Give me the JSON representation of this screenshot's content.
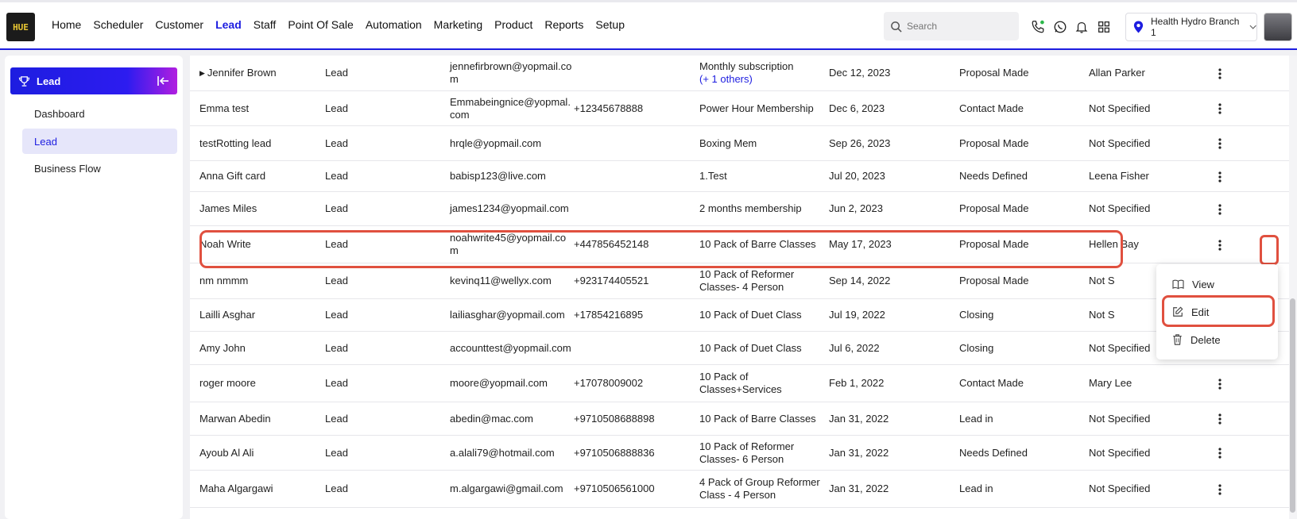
{
  "brand": {
    "logo_text": "HUE"
  },
  "nav": {
    "items": [
      "Home",
      "Scheduler",
      "Customer",
      "Lead",
      "Staff",
      "Point Of Sale",
      "Automation",
      "Marketing",
      "Product",
      "Reports",
      "Setup"
    ],
    "active": "Lead"
  },
  "header": {
    "search_placeholder": "Search",
    "branch": "Health Hydro Branch 1"
  },
  "sidebar": {
    "title": "Lead",
    "items": [
      {
        "label": "Dashboard",
        "active": false
      },
      {
        "label": "Lead",
        "active": true
      },
      {
        "label": "Business Flow",
        "active": false
      }
    ]
  },
  "table": {
    "rows": [
      {
        "name": "Jennifer Brown",
        "expand": "▶",
        "type": "Lead",
        "email1": "jennefirbrown@yopmail.co",
        "email2": "m",
        "phone": "",
        "plan1": "Monthly subscription",
        "plan2": "(+ 1 others)",
        "date": "Dec 12, 2023",
        "status": "Proposal Made",
        "staff": "Allan Parker"
      },
      {
        "name": "Emma test",
        "type": "Lead",
        "email1": "Emmabeingnice@yopmal.",
        "email2": "com",
        "phone": "+12345678888",
        "plan1": "Power Hour Membership",
        "plan2": "",
        "date": "Dec 6, 2023",
        "status": "Contact Made",
        "staff": "Not Specified"
      },
      {
        "name": "testRotting lead",
        "type": "Lead",
        "email1": "hrqle@yopmail.com",
        "email2": "",
        "phone": "",
        "plan1": "Boxing Mem",
        "plan2": "",
        "date": "Sep 26, 2023",
        "status": "Proposal Made",
        "staff": "Not Specified"
      },
      {
        "name": "Anna Gift card",
        "type": "Lead",
        "email1": "babisp123@live.com",
        "email2": "",
        "phone": "",
        "plan1": "1.Test",
        "plan2": "",
        "date": "Jul 20, 2023",
        "status": "Needs Defined",
        "staff": "Leena Fisher"
      },
      {
        "name": "James Miles",
        "type": "Lead",
        "email1": "james1234@yopmail.com",
        "email2": "",
        "phone": "",
        "plan1": "2 months membership",
        "plan2": "",
        "date": "Jun 2, 2023",
        "status": "Proposal Made",
        "staff": "Not Specified"
      },
      {
        "name": "Noah Write",
        "type": "Lead",
        "email1": "noahwrite45@yopmail.co",
        "email2": "m",
        "phone": "+447856452148",
        "plan1": "10 Pack of Barre Classes",
        "plan2": "",
        "date": "May 17, 2023",
        "status": "Proposal Made",
        "staff": "Hellen Bay"
      },
      {
        "name": "nm nmmm",
        "type": "Lead",
        "email1": "kevinq11@wellyx.com",
        "email2": "",
        "phone": "+923174405521",
        "plan1": "10 Pack of Reformer",
        "plan2": "Classes- 4 Person",
        "date": "Sep 14, 2022",
        "status": "Proposal Made",
        "staff": "Not S"
      },
      {
        "name": "Lailli Asghar",
        "type": "Lead",
        "email1": "lailiasghar@yopmail.com",
        "email2": "",
        "phone": "+17854216895",
        "plan1": "10 Pack of Duet Class",
        "plan2": "",
        "date": "Jul 19, 2022",
        "status": "Closing",
        "staff": "Not S"
      },
      {
        "name": "Amy John",
        "type": "Lead",
        "email1": "accounttest@yopmail.com",
        "email2": "",
        "phone": "",
        "plan1": "10 Pack of Duet Class",
        "plan2": "",
        "date": "Jul 6, 2022",
        "status": "Closing",
        "staff": "Not Specified"
      },
      {
        "name": "roger moore",
        "type": "Lead",
        "email1": "moore@yopmail.com",
        "email2": "",
        "phone": "+17078009002",
        "plan1": "10 Pack of",
        "plan2": "Classes+Services",
        "date": "Feb 1, 2022",
        "status": "Contact Made",
        "staff": "Mary Lee"
      },
      {
        "name": "Marwan Abedin",
        "type": "Lead",
        "email1": "abedin@mac.com",
        "email2": "",
        "phone": "+9710508688898",
        "plan1": "10 Pack of Barre Classes",
        "plan2": "",
        "date": "Jan 31, 2022",
        "status": "Lead in",
        "staff": "Not Specified"
      },
      {
        "name": "Ayoub Al Ali",
        "type": "Lead",
        "email1": "a.alali79@hotmail.com",
        "email2": "",
        "phone": "+9710506888836",
        "plan1": "10 Pack of Reformer",
        "plan2": "Classes- 6 Person",
        "date": "Jan 31, 2022",
        "status": "Needs Defined",
        "staff": "Not Specified"
      },
      {
        "name": "Maha Algargawi",
        "type": "Lead",
        "email1": "m.algargawi@gmail.com",
        "email2": "",
        "phone": "+9710506561000",
        "plan1": "4 Pack of Group Reformer",
        "plan2": "Class - 4 Person",
        "date": "Jan 31, 2022",
        "status": "Lead in",
        "staff": "Not Specified"
      }
    ]
  },
  "row_menu": {
    "items": [
      {
        "label": "View",
        "icon": "book-open-icon"
      },
      {
        "label": "Edit",
        "icon": "edit-icon"
      },
      {
        "label": "Delete",
        "icon": "trash-icon"
      }
    ]
  },
  "colors": {
    "accent": "#1d1de0",
    "highlight": "#e0503f"
  }
}
